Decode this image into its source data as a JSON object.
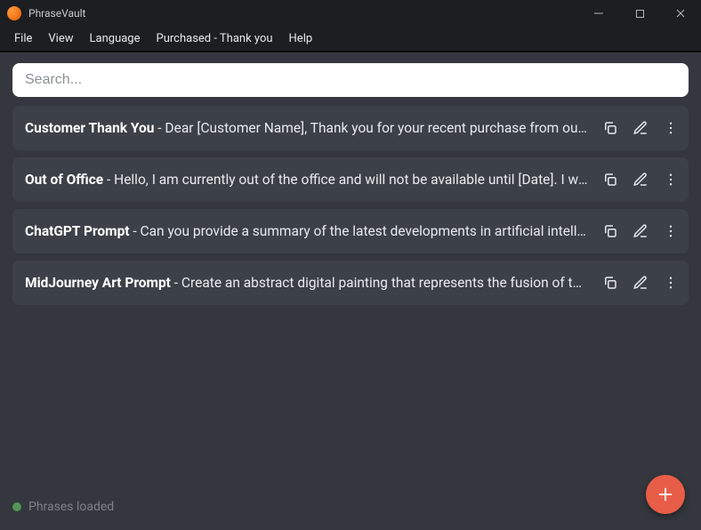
{
  "app": {
    "title": "PhraseVault"
  },
  "menu": {
    "file": "File",
    "view": "View",
    "language": "Language",
    "purchased": "Purchased - Thank you",
    "help": "Help"
  },
  "search": {
    "placeholder": "Search...",
    "value": ""
  },
  "phrases": [
    {
      "title": "Customer Thank You",
      "body": "Dear [Customer Name], Thank you for your recent purchase from our store. We truly appreciate your business."
    },
    {
      "title": "Out of Office",
      "body": "Hello, I am currently out of the office and will not be available until [Date]. I will respond to your message upon my return."
    },
    {
      "title": "ChatGPT Prompt",
      "body": "Can you provide a summary of the latest developments in artificial intelligence research and applications?"
    },
    {
      "title": "MidJourney Art Prompt",
      "body": "Create an abstract digital painting that represents the fusion of technology and nature in vibrant colors."
    }
  ],
  "status": {
    "text": "Phrases loaded"
  },
  "separator": " - "
}
